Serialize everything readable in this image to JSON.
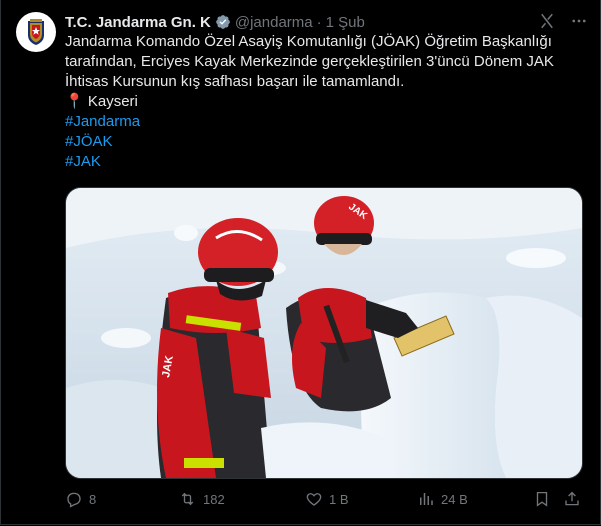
{
  "tweet": {
    "author_name": "T.C. Jandarma Gn. K",
    "handle": "@jandarma",
    "separator": "·",
    "time": "1 Şub",
    "text_lines": [
      "Jandarma Komando Özel Asayiş Komutanlığı (JÖAK) Öğretim Başkanlığı",
      "tarafından, Erciyes Kayak Merkezinde gerçekleştirilen 3'üncü Dönem JAK",
      "İhtisas Kursunun kış safhası başarı ile tamamlandı."
    ],
    "location_pin": "📍",
    "location": "Kayseri",
    "hashtags": [
      "#Jandarma",
      "#JÖAK",
      "#JAK"
    ],
    "media": {
      "helmet_text": "JAK",
      "jacket_text": "JAK"
    }
  },
  "actions": {
    "replies": "8",
    "reposts": "182",
    "likes": "1 B",
    "views": "24 B"
  },
  "icons": {
    "verified": "verified-badge-icon",
    "grok": "grok-icon",
    "more": "more-icon",
    "reply": "reply-icon",
    "repost": "repost-icon",
    "like": "like-icon",
    "views": "views-icon",
    "bookmark": "bookmark-icon",
    "share": "share-icon"
  },
  "colors": {
    "background": "#000000",
    "text": "#e7e9ea",
    "muted": "#71767b",
    "link": "#1d9bf0",
    "jacket_red": "#c8161e",
    "helmet_red": "#d42027"
  }
}
